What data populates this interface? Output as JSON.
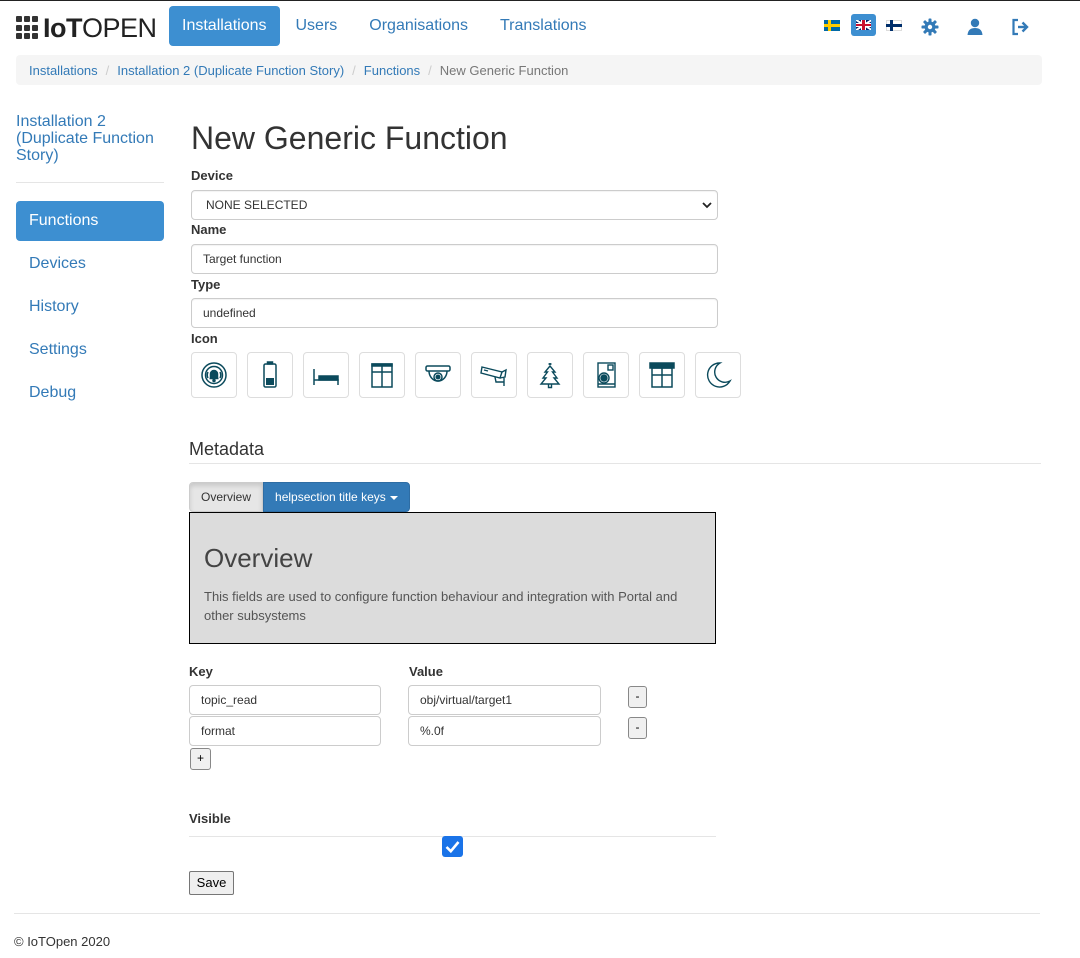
{
  "brand": {
    "bold": "IoT",
    "light": "OPEN"
  },
  "nav": {
    "items": [
      {
        "label": "Installations",
        "active": true
      },
      {
        "label": "Users",
        "active": false
      },
      {
        "label": "Organisations",
        "active": false
      },
      {
        "label": "Translations",
        "active": false
      }
    ],
    "right_icons": [
      "flag-sweden",
      "flag-uk",
      "flag-finland",
      "gear-icon",
      "user-icon",
      "logout-icon"
    ],
    "accent": "#3d8fd1"
  },
  "breadcrumb": [
    "Installations",
    "Installation 2 (Duplicate Function Story)",
    "Functions",
    "New Generic Function"
  ],
  "sidebar": {
    "title": "Installation 2 (Duplicate Function Story)",
    "items": [
      {
        "label": "Functions",
        "active": true
      },
      {
        "label": "Devices",
        "active": false
      },
      {
        "label": "History",
        "active": false
      },
      {
        "label": "Settings",
        "active": false
      },
      {
        "label": "Debug",
        "active": false
      }
    ]
  },
  "form": {
    "title": "New Generic Function",
    "device_label": "Device",
    "device_value": "NONE SELECTED",
    "name_label": "Name",
    "name_value": "Target function",
    "type_label": "Type",
    "type_value": "undefined",
    "icon_label": "Icon",
    "icons": [
      "alarm-icon",
      "battery-icon",
      "bed-icon",
      "window-icon",
      "dome-camera-icon",
      "cctv-camera-icon",
      "christmas-tree-icon",
      "boiler-icon",
      "blind-icon",
      "moon-icon"
    ]
  },
  "metadata": {
    "heading": "Metadata",
    "tab_overview": "Overview",
    "tab_help": "helpsection title keys",
    "overview_title": "Overview",
    "overview_text": "This fields are used to configure function behaviour and integration with Portal and other subsystems",
    "key_header": "Key",
    "value_header": "Value",
    "rows": [
      {
        "key": "topic_read",
        "value": "obj/virtual/target1"
      },
      {
        "key": "format",
        "value": "%.0f"
      }
    ],
    "remove_label": "-",
    "add_label": "+"
  },
  "visible": {
    "label": "Visible",
    "checked": true
  },
  "save_label": "Save",
  "footer": "© IoTOpen 2020"
}
